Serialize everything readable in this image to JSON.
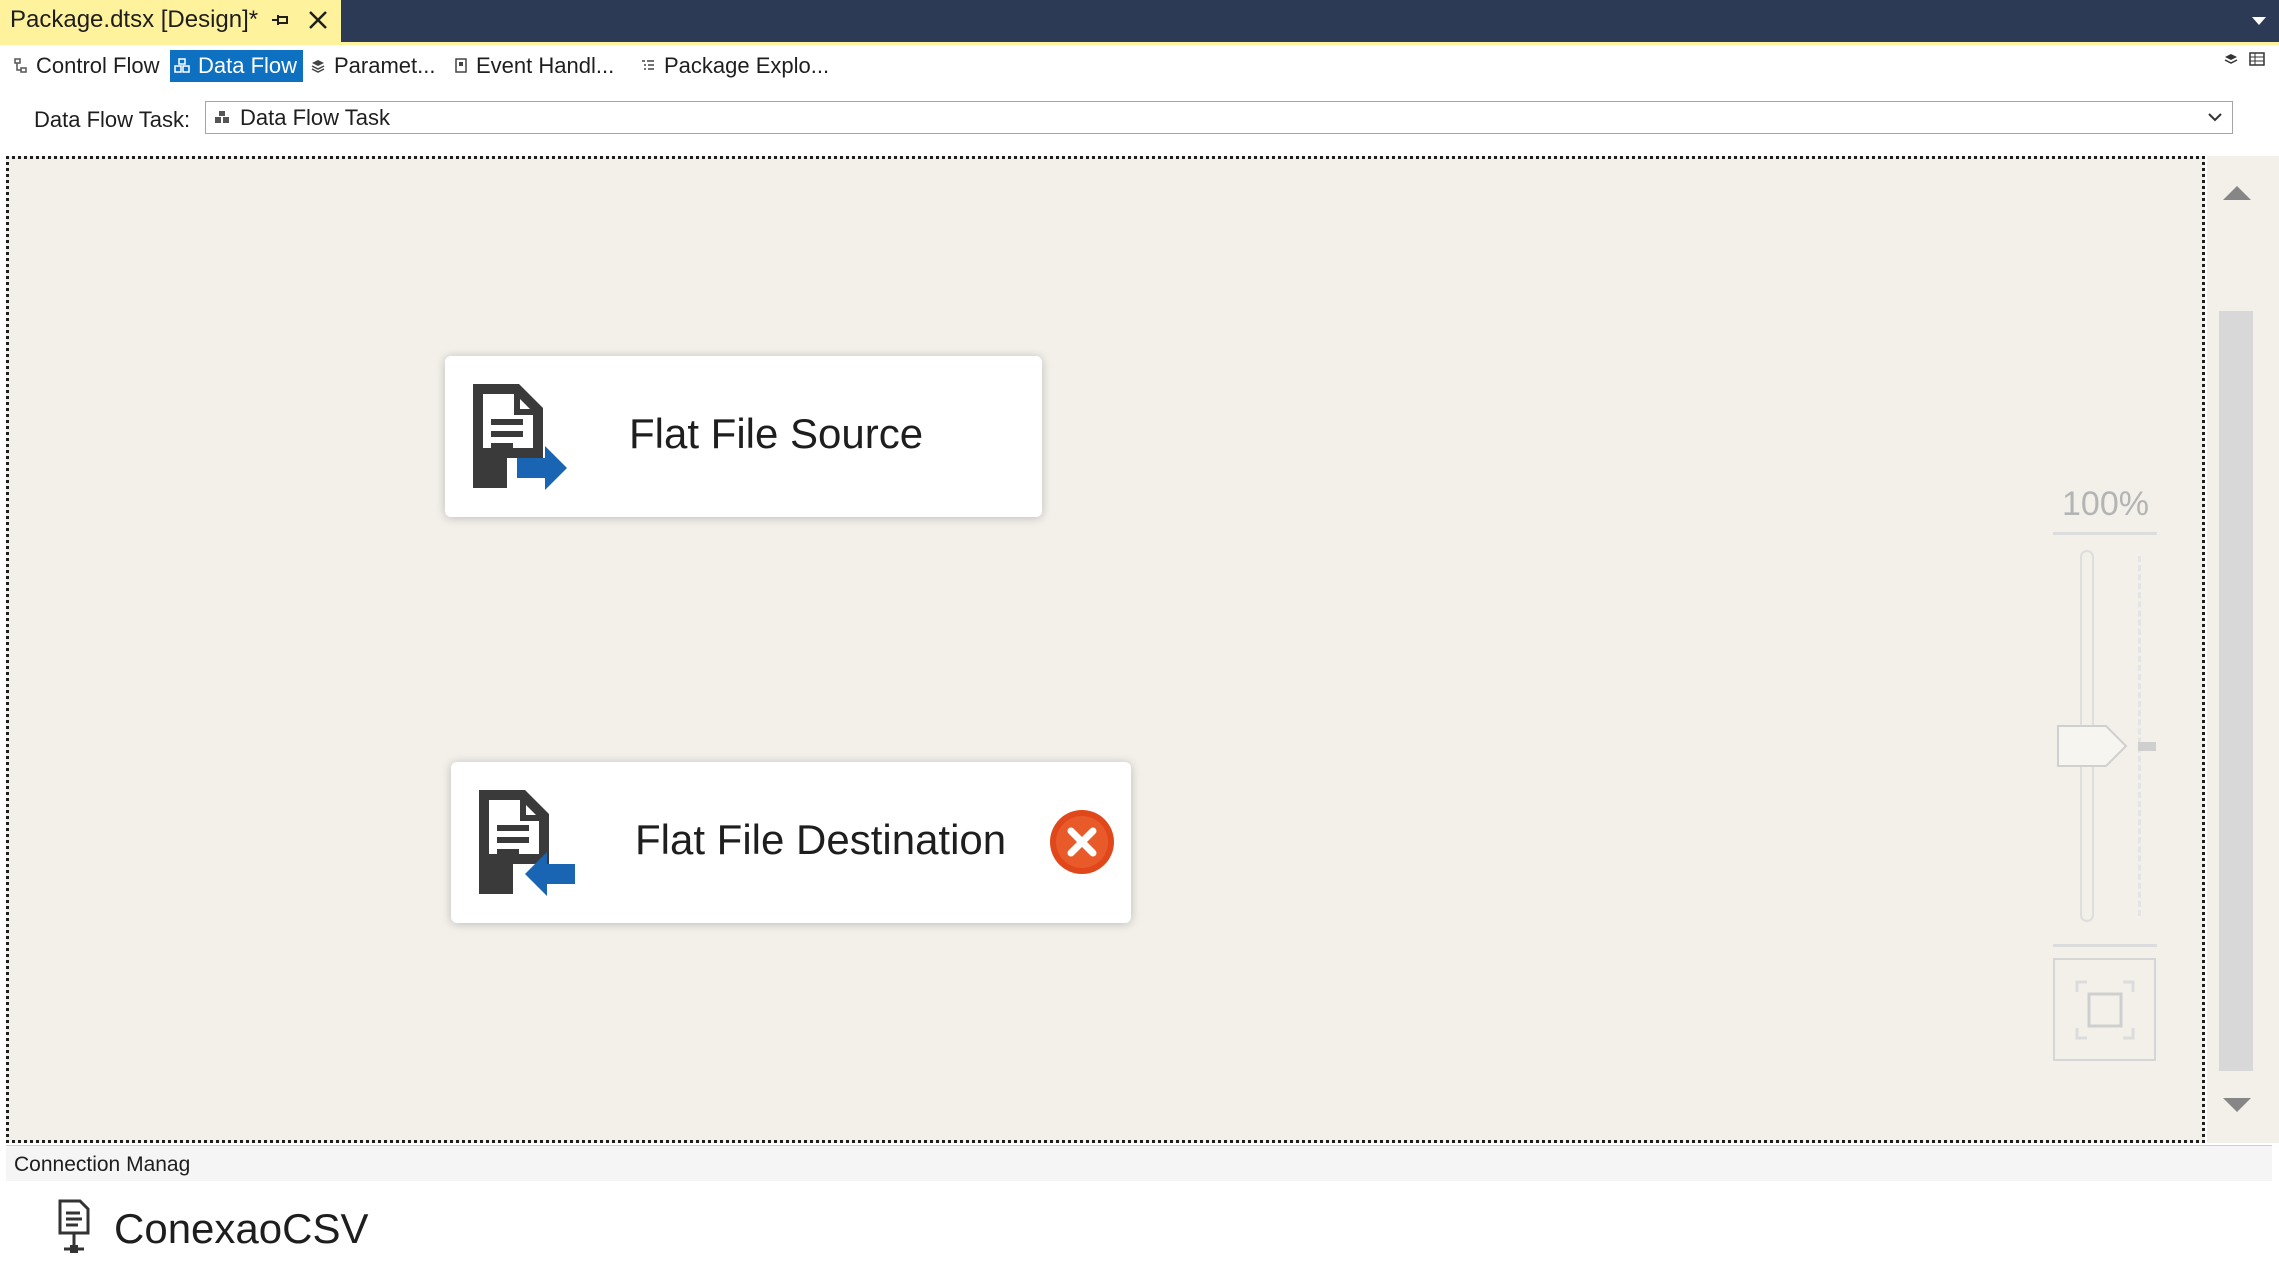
{
  "document_tab": {
    "title": "Package.dtsx [Design]*",
    "pin_icon": "pin-icon",
    "close_icon": "close-icon"
  },
  "designer_tabs": [
    {
      "label": "Control Flow",
      "icon": "control-flow-icon",
      "active": false
    },
    {
      "label": "Data Flow",
      "icon": "data-flow-icon",
      "active": true
    },
    {
      "label": "Paramet...",
      "icon": "parameters-icon",
      "active": false
    },
    {
      "label": "Event Handl...",
      "icon": "event-handlers-icon",
      "active": false
    },
    {
      "label": "Package Explo...",
      "icon": "package-explorer-icon",
      "active": false
    }
  ],
  "task_selector": {
    "label": "Data Flow Task:",
    "value": "Data Flow Task"
  },
  "canvas": {
    "components": [
      {
        "name": "Flat File Source",
        "icon": "flat-file-source-icon",
        "error": false
      },
      {
        "name": "Flat File Destination",
        "icon": "flat-file-destination-icon",
        "error": true
      }
    ],
    "zoom": {
      "label": "100%"
    }
  },
  "connection_managers": {
    "title": "Connection Manag",
    "items": [
      {
        "name": "ConexaoCSV",
        "icon": "flat-file-connection-icon"
      }
    ]
  },
  "colors": {
    "tab_strip": "#2d3a55",
    "active_doc_tab": "#fff29d",
    "active_subtab": "#0e70c0",
    "canvas_bg": "#f3f0ea",
    "arrow_blue": "#1a64b4",
    "error_red": "#e0481c"
  }
}
